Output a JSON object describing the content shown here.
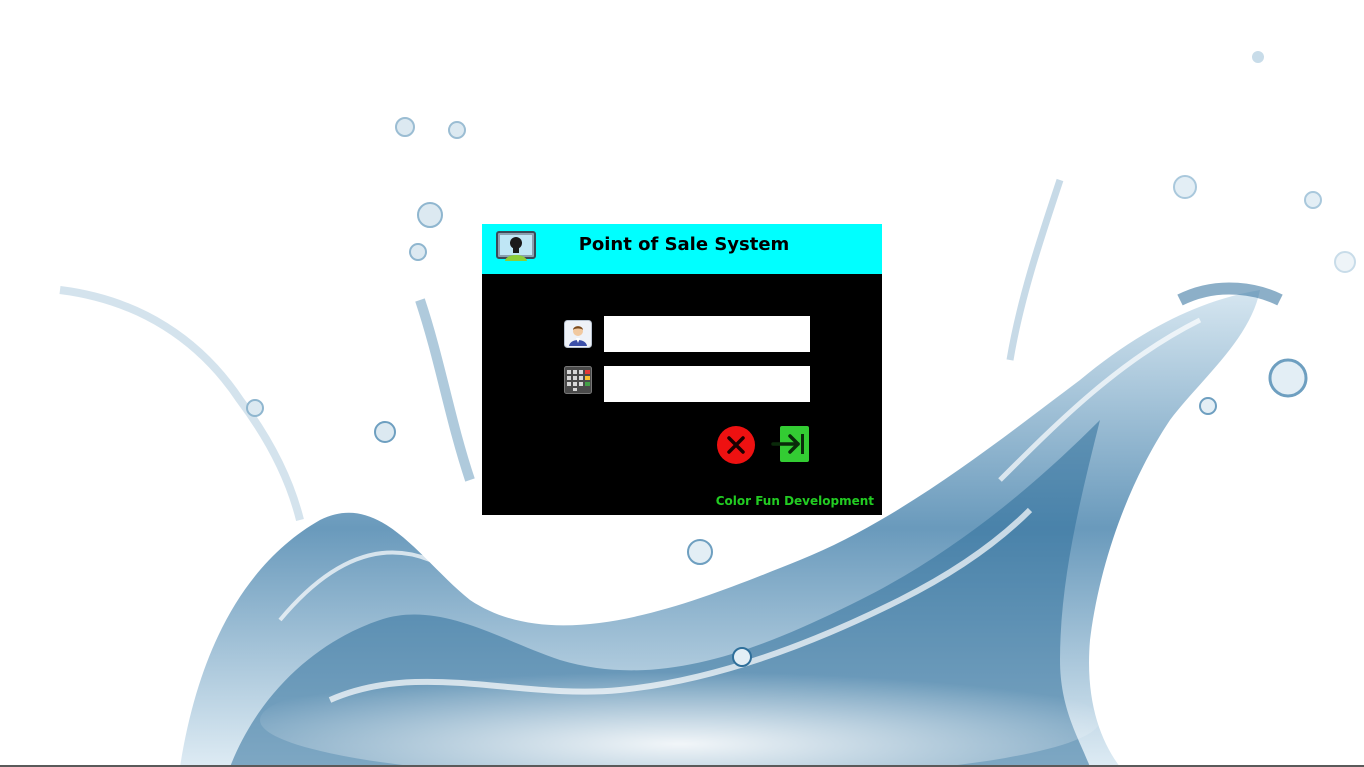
{
  "window": {
    "title": "Point of Sale System",
    "title_bar_color": "#00ffff",
    "body_color": "#000000"
  },
  "icons": {
    "app": "monitor-user-icon",
    "username": "user-avatar-icon",
    "password": "keypad-icon",
    "cancel": "close-circle-icon",
    "login": "sign-in-arrow-icon"
  },
  "form": {
    "username_value": "",
    "password_value": ""
  },
  "footer": {
    "credit": "Color Fun Development",
    "credit_color": "#22cc22"
  },
  "colors": {
    "cancel_red": "#ee1111",
    "login_green": "#33cc33"
  }
}
